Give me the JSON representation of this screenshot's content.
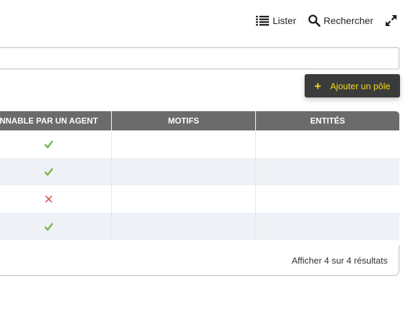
{
  "toolbar": {
    "list_label": "Lister",
    "list_icon": "list-icon",
    "search_label": "Rechercher",
    "search_icon": "search-icon",
    "expand_icon": "expand-icon"
  },
  "search": {
    "value": "",
    "placeholder": ""
  },
  "add_button": {
    "label": "Ajouter un pôle",
    "icon": "plus-icon",
    "color": "#f2d81d",
    "background": "#3b3b3b"
  },
  "table": {
    "columns": [
      "NNABLE PAR UN AGENT",
      "MOTIFS",
      "ENTITÉS"
    ],
    "rows": [
      {
        "agent_selectable": true,
        "motifs": "",
        "entites": ""
      },
      {
        "agent_selectable": true,
        "motifs": "",
        "entites": ""
      },
      {
        "agent_selectable": false,
        "motifs": "",
        "entites": ""
      },
      {
        "agent_selectable": true,
        "motifs": "",
        "entites": ""
      }
    ],
    "icons": {
      "true": "check-icon",
      "false": "cross-icon"
    },
    "colors": {
      "check": "#7ab648",
      "cross": "#e0524f",
      "header": "#6b6b6b",
      "alt_row": "#eef2f6"
    }
  },
  "pagination": {
    "summary": "Afficher 4 sur 4 résultats"
  }
}
